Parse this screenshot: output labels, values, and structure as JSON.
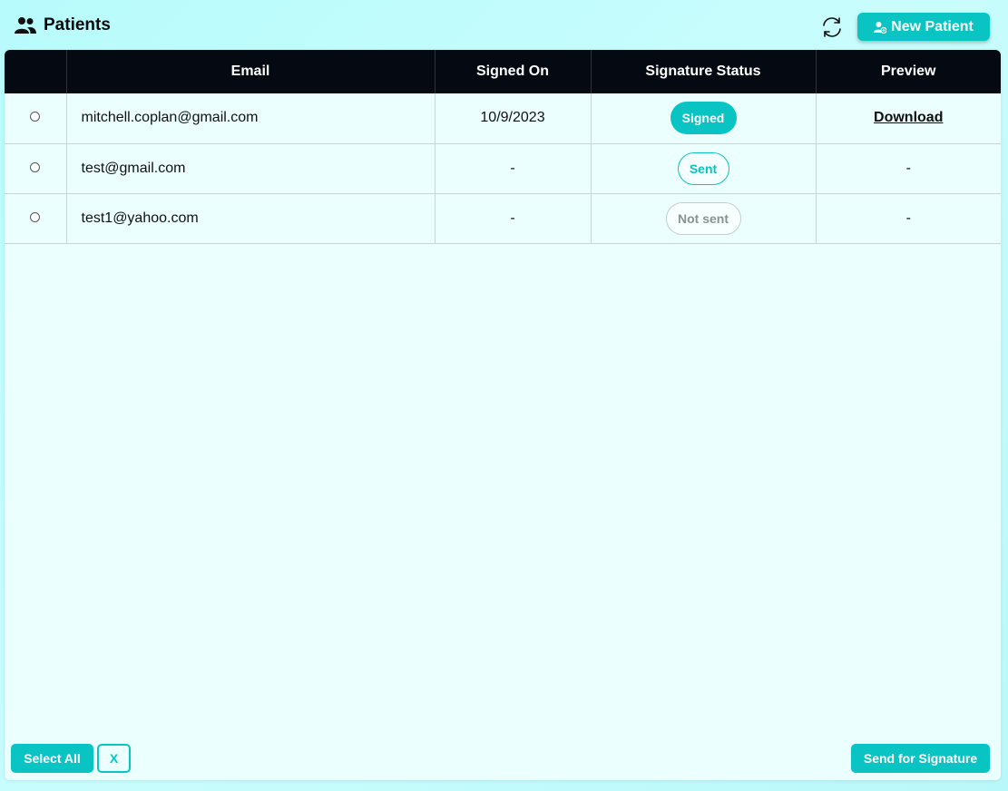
{
  "header": {
    "title": "Patients",
    "title_icon": "users-icon",
    "refresh_icon": "refresh-icon",
    "new_patient_label": "New Patient",
    "new_patient_icon": "user-plus-icon"
  },
  "table": {
    "columns": [
      "",
      "Email",
      "Signed On",
      "Signature Status",
      "Preview"
    ],
    "rows": [
      {
        "email": "mitchell.coplan@gmail.com",
        "signed_on": "10/9/2023",
        "status": "Signed",
        "preview": "Download"
      },
      {
        "email": "test@gmail.com",
        "signed_on": "-",
        "status": "Sent",
        "preview": "-"
      },
      {
        "email": "test1@yahoo.com",
        "signed_on": "-",
        "status": "Not sent",
        "preview": "-"
      }
    ]
  },
  "footer": {
    "select_all_label": "Select All",
    "clear_label": "X",
    "send_label": "Send for Signature"
  },
  "colors": {
    "accent": "#0ac4c4",
    "header_bg": "#050a12",
    "panel_bg": "#eafffe"
  }
}
